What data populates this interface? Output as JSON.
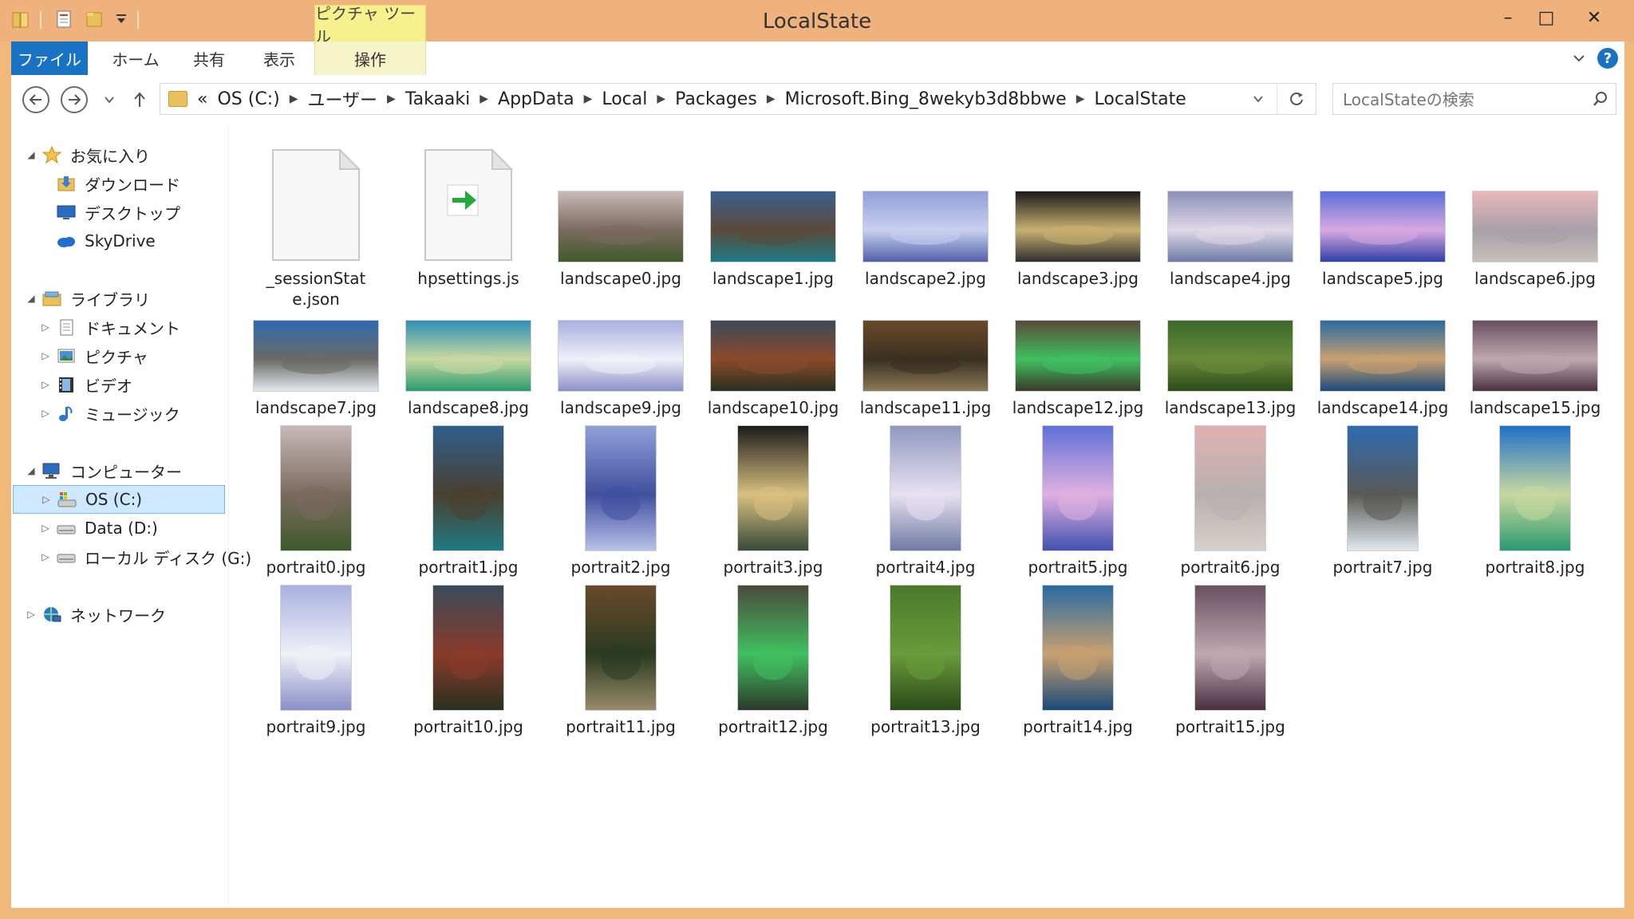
{
  "window": {
    "title": "LocalState",
    "context_tab": "ピクチャ ツール",
    "controls": {
      "minimize": "–",
      "maximize": "□",
      "close": "✕"
    }
  },
  "ribbon": {
    "tabs": [
      "ファイル",
      "ホーム",
      "共有",
      "表示",
      "操作"
    ],
    "help": "?"
  },
  "address": {
    "overflow": "«",
    "crumbs": [
      "OS (C:)",
      "ユーザー",
      "Takaaki",
      "AppData",
      "Local",
      "Packages",
      "Microsoft.Bing_8wekyb3d8bbwe",
      "LocalState"
    ]
  },
  "search": {
    "placeholder": "LocalStateの検索"
  },
  "tree": [
    {
      "label": "お気に入り",
      "icon": "star-icon",
      "level": 0,
      "expanded": true
    },
    {
      "label": "ダウンロード",
      "icon": "download-folder-icon",
      "level": 1
    },
    {
      "label": "デスクトップ",
      "icon": "desktop-icon",
      "level": 1
    },
    {
      "label": "SkyDrive",
      "icon": "cloud-icon",
      "level": 1
    },
    {
      "label": "ライブラリ",
      "icon": "library-icon",
      "level": 0,
      "expanded": true
    },
    {
      "label": "ドキュメント",
      "icon": "documents-icon",
      "level": 1
    },
    {
      "label": "ピクチャ",
      "icon": "pictures-icon",
      "level": 1
    },
    {
      "label": "ビデオ",
      "icon": "video-icon",
      "level": 1
    },
    {
      "label": "ミュージック",
      "icon": "music-icon",
      "level": 1
    },
    {
      "label": "コンピューター",
      "icon": "computer-icon",
      "level": 0,
      "expanded": true
    },
    {
      "label": "OS (C:)",
      "icon": "os-drive-icon",
      "level": 1,
      "selected": true
    },
    {
      "label": "Data (D:)",
      "icon": "drive-icon",
      "level": 1
    },
    {
      "label": "ローカル ディスク (G:)",
      "icon": "drive-icon",
      "level": 1
    },
    {
      "label": "ネットワーク",
      "icon": "network-icon",
      "level": 0
    }
  ],
  "files": [
    {
      "name": "_sessionState.json",
      "type": "blank-file"
    },
    {
      "name": "hpsettings.js",
      "type": "shortcut-file"
    },
    {
      "name": "landscape0.jpg",
      "type": "landscape",
      "colors": [
        "#c9b9b9",
        "#7a6a5e",
        "#3f5a2b"
      ]
    },
    {
      "name": "landscape1.jpg",
      "type": "landscape",
      "colors": [
        "#3a5f8c",
        "#5a4a3a",
        "#1f7a84"
      ]
    },
    {
      "name": "landscape2.jpg",
      "type": "landscape",
      "colors": [
        "#8fa0d8",
        "#c8d0f0",
        "#5060a8"
      ]
    },
    {
      "name": "landscape3.jpg",
      "type": "landscape",
      "colors": [
        "#1b1b1b",
        "#c8b070",
        "#2f2f2f"
      ]
    },
    {
      "name": "landscape4.jpg",
      "type": "landscape",
      "colors": [
        "#8a90b8",
        "#e0d8e8",
        "#6e7aa6"
      ]
    },
    {
      "name": "landscape5.jpg",
      "type": "landscape",
      "colors": [
        "#5a70d8",
        "#d8a8e0",
        "#3040a8"
      ]
    },
    {
      "name": "landscape6.jpg",
      "type": "landscape",
      "colors": [
        "#e8b8b8",
        "#a8a0a8",
        "#c8c0b8"
      ]
    },
    {
      "name": "landscape7.jpg",
      "type": "landscape",
      "colors": [
        "#2f6ab0",
        "#6a6a66",
        "#e0e8ee"
      ]
    },
    {
      "name": "landscape8.jpg",
      "type": "landscape",
      "colors": [
        "#2e90b8",
        "#c8d8a0",
        "#2a9a70"
      ]
    },
    {
      "name": "landscape9.jpg",
      "type": "landscape",
      "colors": [
        "#a8b0e0",
        "#f0f0f8",
        "#8a90c8"
      ]
    },
    {
      "name": "landscape10.jpg",
      "type": "landscape",
      "colors": [
        "#3a4a5a",
        "#8a4a2a",
        "#2a3020"
      ]
    },
    {
      "name": "landscape11.jpg",
      "type": "landscape",
      "colors": [
        "#6a4a2a",
        "#3a3020",
        "#8a7a5a"
      ]
    },
    {
      "name": "landscape12.jpg",
      "type": "landscape",
      "colors": [
        "#5a4a3a",
        "#40c060",
        "#3a3a2a"
      ]
    },
    {
      "name": "landscape13.jpg",
      "type": "landscape",
      "colors": [
        "#3a6a2a",
        "#6a8a3a",
        "#2a4a1a"
      ]
    },
    {
      "name": "landscape14.jpg",
      "type": "landscape",
      "colors": [
        "#2a6aa0",
        "#c8a070",
        "#1a4a7a"
      ]
    },
    {
      "name": "landscape15.jpg",
      "type": "landscape",
      "colors": [
        "#6a5060",
        "#c0a8b0",
        "#4a3040"
      ]
    },
    {
      "name": "portrait0.jpg",
      "type": "portrait",
      "colors": [
        "#c9b9b9",
        "#7a6a5e",
        "#3f5a2b"
      ]
    },
    {
      "name": "portrait1.jpg",
      "type": "portrait",
      "colors": [
        "#2f5f8c",
        "#4a4030",
        "#1f7a84"
      ]
    },
    {
      "name": "portrait2.jpg",
      "type": "portrait",
      "colors": [
        "#8fa0d8",
        "#4050a0",
        "#b8c0e8"
      ]
    },
    {
      "name": "portrait3.jpg",
      "type": "portrait",
      "colors": [
        "#1b1b1b",
        "#d8c080",
        "#3a4a3a"
      ]
    },
    {
      "name": "portrait4.jpg",
      "type": "portrait",
      "colors": [
        "#9098c0",
        "#e8e0f0",
        "#6e7aa6"
      ]
    },
    {
      "name": "portrait5.jpg",
      "type": "portrait",
      "colors": [
        "#6070d8",
        "#e0b0e0",
        "#4050b0"
      ]
    },
    {
      "name": "portrait6.jpg",
      "type": "portrait",
      "colors": [
        "#e0b0b0",
        "#b8b0b0",
        "#d8d0c8"
      ]
    },
    {
      "name": "portrait7.jpg",
      "type": "portrait",
      "colors": [
        "#2f6ab0",
        "#5a5a56",
        "#e0e8ee"
      ]
    },
    {
      "name": "portrait8.jpg",
      "type": "portrait",
      "colors": [
        "#2070c8",
        "#c8d8a0",
        "#2a9a70"
      ]
    },
    {
      "name": "portrait9.jpg",
      "type": "portrait",
      "colors": [
        "#a8b0e0",
        "#f0f0f8",
        "#8a90c8"
      ]
    },
    {
      "name": "portrait10.jpg",
      "type": "portrait",
      "colors": [
        "#3a4a5a",
        "#8a3a2a",
        "#2a3020"
      ]
    },
    {
      "name": "portrait11.jpg",
      "type": "portrait",
      "colors": [
        "#6a4a2a",
        "#2a3a20",
        "#9a8a6a"
      ]
    },
    {
      "name": "portrait12.jpg",
      "type": "portrait",
      "colors": [
        "#4a4a3a",
        "#40c060",
        "#2a3a2a"
      ]
    },
    {
      "name": "portrait13.jpg",
      "type": "portrait",
      "colors": [
        "#4a7a2a",
        "#6a9a3a",
        "#2a4a1a"
      ]
    },
    {
      "name": "portrait14.jpg",
      "type": "portrait",
      "colors": [
        "#2a6aa0",
        "#c8a070",
        "#1a4a7a"
      ]
    },
    {
      "name": "portrait15.jpg",
      "type": "portrait",
      "colors": [
        "#6a5060",
        "#c0a8b0",
        "#4a3040"
      ]
    }
  ]
}
